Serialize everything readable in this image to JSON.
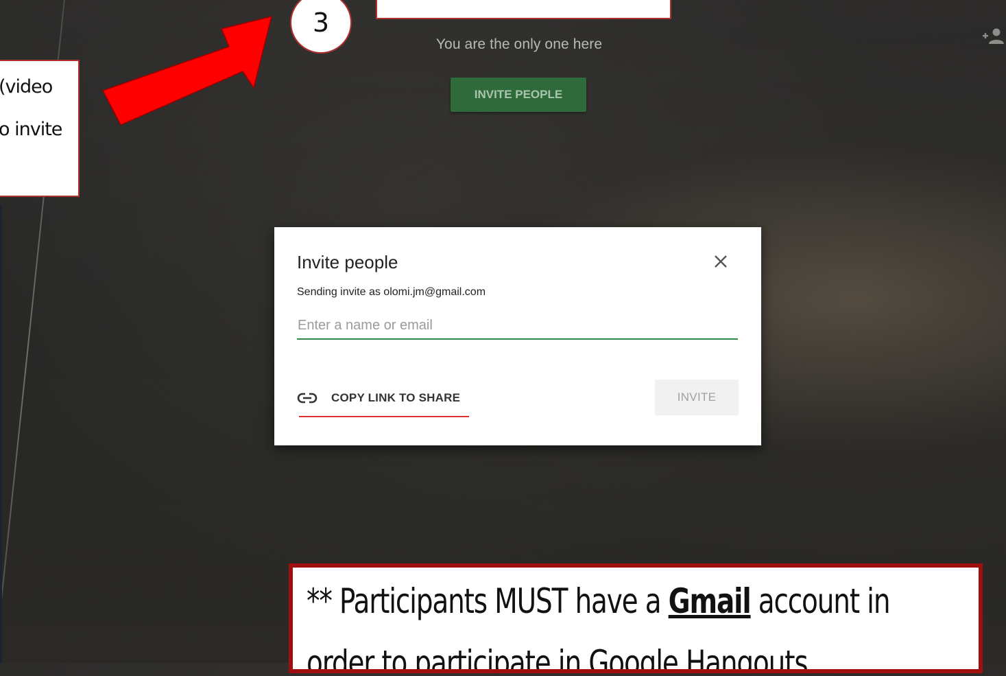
{
  "call": {
    "status_message": "You are the only one here",
    "invite_people_button": "INVITE PEOPLE",
    "add_person_icon": "add-person-icon"
  },
  "dialog": {
    "title": "Invite people",
    "sending_as": "Sending invite as olomi.jm@gmail.com",
    "input_placeholder": "Enter a name or email",
    "input_value": "",
    "copy_link_label": "COPY LINK TO SHARE",
    "invite_button": "INVITE",
    "close_icon": "close-icon",
    "link_icon": "link-icon"
  },
  "annotations": {
    "step_number": "3",
    "left_note_line1": "(video",
    "left_note_line2": "o invite",
    "bottom_note_prefix": "** Participants MUST have a ",
    "bottom_note_bold": "Gmail",
    "bottom_note_suffix": " account in",
    "bottom_note_line2": "order to participate in Google Hangouts",
    "highlight_color": "#d93030",
    "arrow_color": "#ff0000"
  }
}
